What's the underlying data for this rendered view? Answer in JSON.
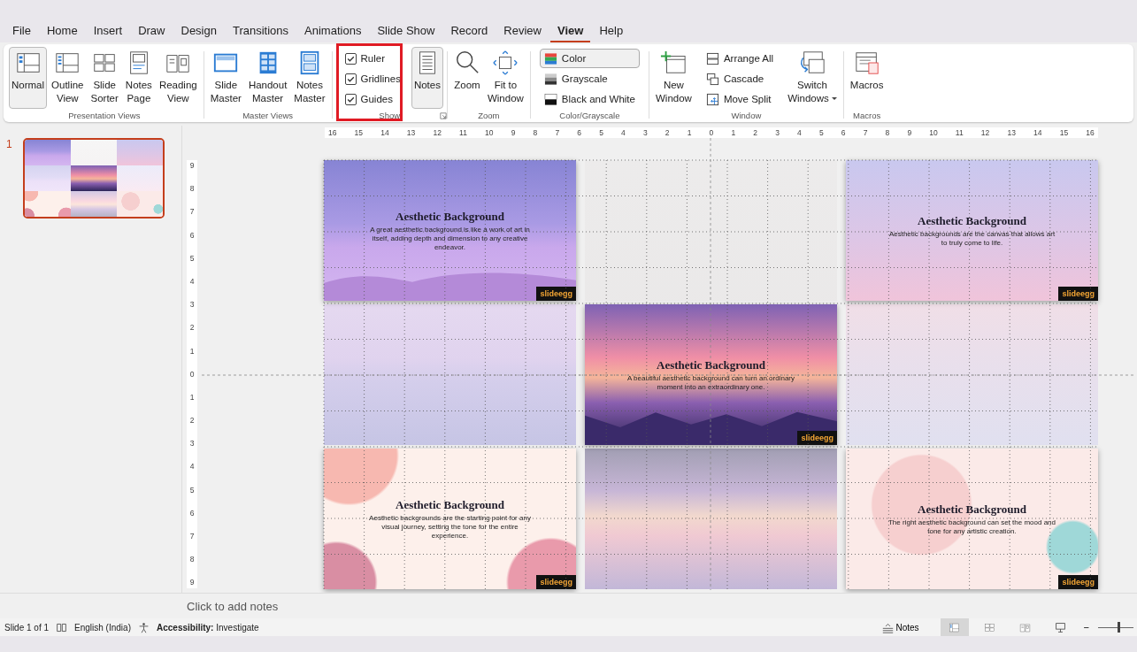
{
  "menu_tabs": [
    {
      "label": "File",
      "selected": false
    },
    {
      "label": "Home",
      "selected": false
    },
    {
      "label": "Insert",
      "selected": false
    },
    {
      "label": "Draw",
      "selected": false
    },
    {
      "label": "Design",
      "selected": false
    },
    {
      "label": "Transitions",
      "selected": false
    },
    {
      "label": "Animations",
      "selected": false
    },
    {
      "label": "Slide Show",
      "selected": false
    },
    {
      "label": "Record",
      "selected": false
    },
    {
      "label": "Review",
      "selected": false
    },
    {
      "label": "View",
      "selected": true
    },
    {
      "label": "Help",
      "selected": false
    }
  ],
  "ribbon": {
    "groups": [
      {
        "label": "Presentation Views",
        "items": [
          {
            "kind": "large",
            "label": "Normal",
            "selected": true
          },
          {
            "kind": "large",
            "label": "Outline\nView",
            "selected": false
          },
          {
            "kind": "large",
            "label": "Slide\nSorter",
            "selected": false
          },
          {
            "kind": "large",
            "label": "Notes\nPage",
            "selected": false
          },
          {
            "kind": "large",
            "label": "Reading\nView",
            "selected": false
          }
        ]
      },
      {
        "label": "Master Views",
        "items": [
          {
            "kind": "large",
            "label": "Slide\nMaster",
            "selected": false
          },
          {
            "kind": "large",
            "label": "Handout\nMaster",
            "selected": false
          },
          {
            "kind": "large",
            "label": "Notes\nMaster",
            "selected": false
          }
        ]
      },
      {
        "label": "Show",
        "highlight": true,
        "launcher": true,
        "items": [
          {
            "kind": "stack",
            "items": [
              {
                "kind": "check",
                "label": "Ruler",
                "checked": true
              },
              {
                "kind": "check",
                "label": "Gridlines",
                "checked": true
              },
              {
                "kind": "check",
                "label": "Guides",
                "checked": true
              }
            ]
          },
          {
            "kind": "large",
            "label": "Notes",
            "selected": true
          }
        ]
      },
      {
        "label": "Zoom",
        "items": [
          {
            "kind": "large",
            "label": "Zoom",
            "selected": false
          },
          {
            "kind": "large",
            "label": "Fit to\nWindow",
            "selected": false
          }
        ]
      },
      {
        "label": "Color/Grayscale",
        "items": [
          {
            "kind": "stack",
            "items": [
              {
                "kind": "small",
                "label": "Color",
                "selected": true
              },
              {
                "kind": "small",
                "label": "Grayscale",
                "selected": false
              },
              {
                "kind": "small",
                "label": "Black and White",
                "selected": false
              }
            ]
          }
        ]
      },
      {
        "label": "Window",
        "items": [
          {
            "kind": "large",
            "label": "New\nWindow",
            "selected": false
          },
          {
            "kind": "stack",
            "items": [
              {
                "kind": "small",
                "label": "Arrange All",
                "selected": false
              },
              {
                "kind": "small",
                "label": "Cascade",
                "selected": false
              },
              {
                "kind": "small",
                "label": "Move Split",
                "selected": false
              }
            ]
          },
          {
            "kind": "large",
            "label": "Switch\nWindows",
            "selected": false,
            "dropdown": true
          }
        ]
      },
      {
        "label": "Macros",
        "items": [
          {
            "kind": "large",
            "label": "Macros",
            "selected": false
          }
        ]
      }
    ]
  },
  "thumbnails": [
    {
      "number": "1",
      "selected": true
    }
  ],
  "ruler": {
    "horizontal": [
      "16",
      "15",
      "14",
      "13",
      "12",
      "11",
      "10",
      "9",
      "8",
      "7",
      "6",
      "5",
      "4",
      "3",
      "2",
      "1",
      "0",
      "1",
      "2",
      "3",
      "4",
      "5",
      "6",
      "7",
      "8",
      "9",
      "10",
      "11",
      "12",
      "13",
      "14",
      "15",
      "16"
    ],
    "vertical": [
      "9",
      "8",
      "7",
      "6",
      "5",
      "4",
      "3",
      "2",
      "1",
      "0",
      "1",
      "2",
      "3",
      "4",
      "5",
      "6",
      "7",
      "8",
      "9"
    ]
  },
  "slides": [
    {
      "kind": "slide",
      "title": "Aesthetic Background",
      "body": "A great aesthetic background is like a work of art in itself, adding depth and dimension to any creative endeavor.",
      "logo": "slideegg"
    },
    {
      "kind": "reflection"
    },
    {
      "kind": "slide",
      "title": "Aesthetic Background",
      "body": "Aesthetic backgrounds are the canvas that allows art to truly come to life.",
      "logo": "slideegg"
    },
    {
      "kind": "reflection"
    },
    {
      "kind": "slide",
      "title": "Aesthetic Background",
      "body": "A beautiful aesthetic background can turn an ordinary moment into an extraordinary one.",
      "logo": "slideegg"
    },
    {
      "kind": "reflection"
    },
    {
      "kind": "slide",
      "title": "Aesthetic Background",
      "body": "Aesthetic backgrounds are the starting point for any visual journey, setting the tone for the entire experience.",
      "logo": "slideegg"
    },
    {
      "kind": "reflection"
    },
    {
      "kind": "slide",
      "title": "Aesthetic Background",
      "body": "The right aesthetic background can set the mood and tone for any artistic creation.",
      "logo": "slideegg"
    }
  ],
  "notes": {
    "placeholder": "Click to add notes"
  },
  "status_bar": {
    "slide": "Slide 1 of 1",
    "language": "English (India)",
    "accessibility": "**Accessibility:** Investigate",
    "notes": "Notes",
    "views": [
      {
        "selected": true
      },
      {
        "selected": false
      },
      {
        "selected": false
      },
      {
        "selected": false
      }
    ],
    "zoom_out": "−",
    "zoom": {
      "level": 0.55
    }
  }
}
